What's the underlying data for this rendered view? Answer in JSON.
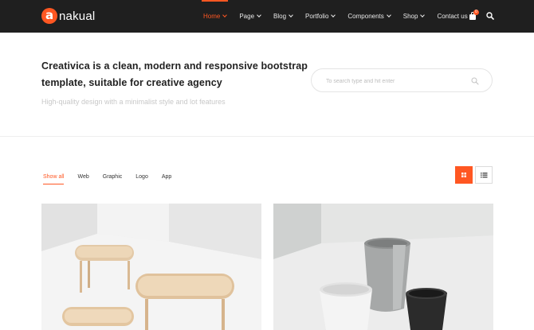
{
  "header": {
    "logo_mark": "a",
    "logo_text": "nakual",
    "nav": [
      {
        "label": "Home",
        "active": true,
        "dropdown": true
      },
      {
        "label": "Page",
        "active": false,
        "dropdown": true
      },
      {
        "label": "Blog",
        "active": false,
        "dropdown": true
      },
      {
        "label": "Portfolio",
        "active": false,
        "dropdown": true
      },
      {
        "label": "Components",
        "active": false,
        "dropdown": true
      },
      {
        "label": "Shop",
        "active": false,
        "dropdown": true
      },
      {
        "label": "Contact us",
        "active": false,
        "dropdown": false
      }
    ],
    "cart_count": "0",
    "icons": {
      "cart": "shopping-bag-icon",
      "search": "search-icon"
    }
  },
  "hero": {
    "title": "Creativica is a clean, modern and responsive bootstrap template, suitable for creative agency",
    "subtitle": "High-quality design with a minimalist style and lot features",
    "search_placeholder": "To search type and hit enter"
  },
  "portfolio": {
    "filters": [
      {
        "label": "Show all",
        "active": true
      },
      {
        "label": "Web",
        "active": false
      },
      {
        "label": "Graphic",
        "active": false
      },
      {
        "label": "Logo",
        "active": false
      },
      {
        "label": "App",
        "active": false
      }
    ],
    "view_modes": {
      "grid": "grid-view-icon",
      "list": "list-view-icon",
      "active": "grid"
    },
    "items": [
      "wooden-side-tables-image",
      "ceramic-cups-image"
    ]
  },
  "colors": {
    "accent": "#ff5722",
    "header_bg": "#1f1f1f",
    "text": "#222222",
    "muted": "#c8c8c8"
  }
}
